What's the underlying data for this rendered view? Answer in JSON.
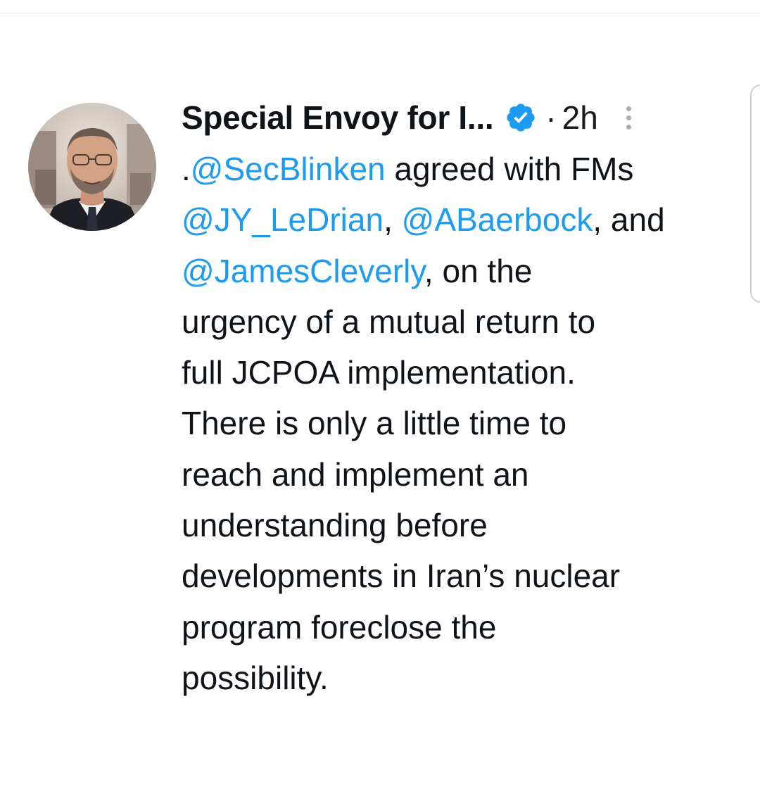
{
  "tweet": {
    "author_name": "Special Envoy for I...",
    "separator": "·",
    "timestamp": "2h",
    "verified": true,
    "more_icon": "more-vertical-icon",
    "lines": [
      [
        {
          "t": ".",
          "m": false
        },
        {
          "t": "@SecBlinken",
          "m": true
        },
        {
          "t": " agreed with FMs",
          "m": false
        }
      ],
      [
        {
          "t": "@JY_LeDrian",
          "m": true
        },
        {
          "t": ", ",
          "m": false
        },
        {
          "t": "@ABaerbock",
          "m": true
        },
        {
          "t": ", and",
          "m": false
        }
      ],
      [
        {
          "t": "@JamesCleverly",
          "m": true
        },
        {
          "t": ", on the",
          "m": false
        }
      ],
      [
        {
          "t": "urgency of a mutual return to",
          "m": false
        }
      ],
      [
        {
          "t": "full JCPOA implementation.",
          "m": false
        }
      ],
      [
        {
          "t": "There is only a little time to",
          "m": false
        }
      ],
      [
        {
          "t": "reach and implement an",
          "m": false
        }
      ],
      [
        {
          "t": "understanding before",
          "m": false
        }
      ],
      [
        {
          "t": "developments in Iran’s nuclear",
          "m": false
        }
      ],
      [
        {
          "t": "program foreclose the",
          "m": false
        }
      ],
      [
        {
          "t": "possibility.",
          "m": false
        }
      ]
    ]
  },
  "colors": {
    "mention": "#1d9bf0",
    "verified_badge": "#1d9bf0",
    "text": "#0f1419"
  }
}
